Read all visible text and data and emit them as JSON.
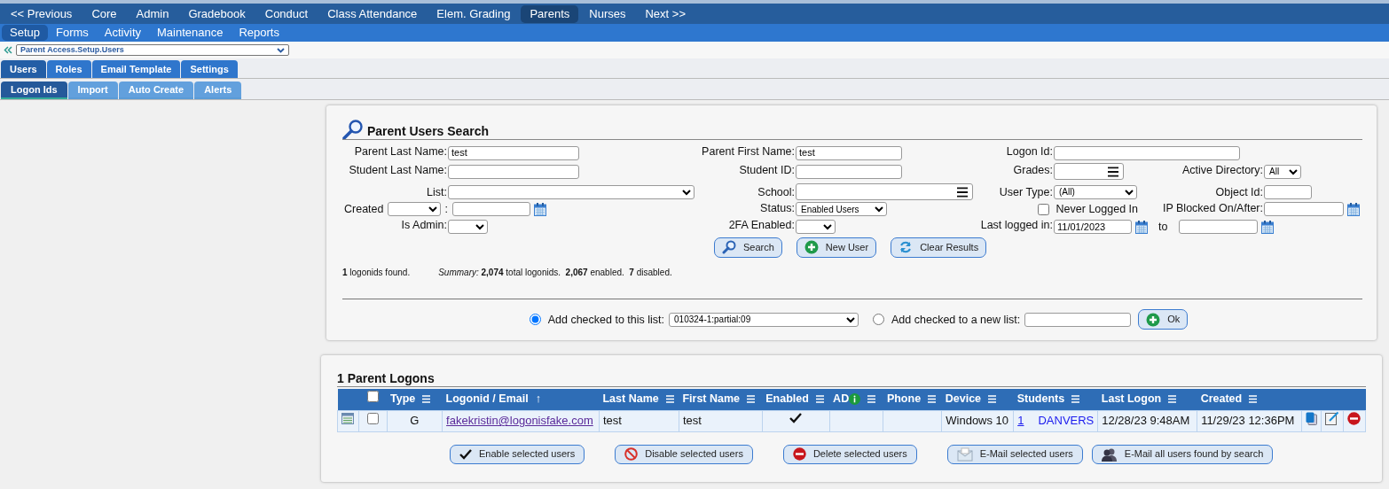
{
  "top_nav": [
    {
      "label": "<< Previous",
      "selected": false
    },
    {
      "label": "Core",
      "selected": false
    },
    {
      "label": "Admin",
      "selected": false
    },
    {
      "label": "Gradebook",
      "selected": false
    },
    {
      "label": "Conduct",
      "selected": false
    },
    {
      "label": "Class Attendance",
      "selected": false
    },
    {
      "label": "Elem. Grading",
      "selected": false
    },
    {
      "label": "Parents",
      "selected": true
    },
    {
      "label": "Nurses",
      "selected": false
    },
    {
      "label": "Next >>",
      "selected": false
    }
  ],
  "sub_nav": [
    {
      "label": "Setup",
      "selected": true
    },
    {
      "label": "Forms",
      "selected": false
    },
    {
      "label": "Activity",
      "selected": false
    },
    {
      "label": "Maintenance",
      "selected": false
    },
    {
      "label": "Reports",
      "selected": false
    }
  ],
  "breadcrumb": {
    "value": "Parent Access.Setup.Users"
  },
  "tabs": [
    {
      "label": "Users",
      "selected": true
    },
    {
      "label": "Roles",
      "selected": false
    },
    {
      "label": "Email Template",
      "selected": false
    },
    {
      "label": "Settings",
      "selected": false
    }
  ],
  "subtabs": [
    {
      "label": "Logon Ids",
      "selected": true
    },
    {
      "label": "Import",
      "selected": false
    },
    {
      "label": "Auto Create",
      "selected": false
    },
    {
      "label": "Alerts",
      "selected": false
    }
  ],
  "search": {
    "title": "Parent Users Search",
    "fields": [
      {
        "kind": "text",
        "label": "Parent Last Name:",
        "value": "test"
      },
      {
        "kind": "text",
        "label": "Parent First Name:",
        "value": "test"
      },
      {
        "kind": "text",
        "label": "Logon Id:"
      },
      {
        "kind": "text",
        "label": "Student Last Name:"
      },
      {
        "kind": "text",
        "label": "Student ID:"
      },
      {
        "kind": "lookup",
        "label": "Grades:"
      },
      {
        "kind": "select",
        "label": "Active Directory:",
        "value": "All"
      },
      {
        "kind": "select",
        "label": "List:"
      },
      {
        "kind": "lookup",
        "label": "School:"
      },
      {
        "kind": "select",
        "label": "User Type:",
        "value": "(All)"
      },
      {
        "kind": "text",
        "label": "Object Id:"
      },
      {
        "kind": "select_date",
        "label": "Created",
        "separator": ":"
      },
      {
        "kind": "select",
        "label": "Status:",
        "value": "Enabled Users"
      },
      {
        "kind": "checkbox",
        "label": "Never Logged In",
        "checked": false
      },
      {
        "kind": "date",
        "label": "IP Blocked On/After:"
      },
      {
        "kind": "select",
        "label": "Is Admin:"
      },
      {
        "kind": "select",
        "label": "2FA Enabled:"
      },
      {
        "kind": "date_range",
        "label": "Last logged in:",
        "value": "11/01/2023",
        "separator": "to"
      }
    ],
    "buttons": [
      {
        "label": "Search"
      },
      {
        "label": "New User"
      },
      {
        "label": "Clear Results"
      }
    ],
    "found": "**1** logonids found.",
    "summary": "*Summary:* **2,074** total logonids.  **2,067** enabled.  **7** disabled.",
    "list_options": [
      {
        "label": "Add checked to this list:",
        "selected": true,
        "kind": "select",
        "value": "010324-1:partial:09"
      },
      {
        "label": "Add checked to a new list:",
        "selected": false,
        "kind": "text"
      }
    ],
    "ok_button": "Ok"
  },
  "results": {
    "title": "1 Parent Logons",
    "select_all_checked": false,
    "columns": [
      {
        "label": "Type"
      },
      {
        "label": "Logonid / Email",
        "sort": "↑"
      },
      {
        "label": "Last Name"
      },
      {
        "label": "First Name"
      },
      {
        "label": "Enabled"
      },
      {
        "label": "AD",
        "info": true
      },
      {
        "label": "Phone"
      },
      {
        "label": "Device"
      },
      {
        "label": "Students"
      },
      {
        "label": "Last Logon"
      },
      {
        "label": "Created"
      }
    ],
    "rows": [
      {
        "checked": false,
        "type": "G",
        "logonid": "fakekristin@logonisfake.com",
        "last_name": "test",
        "first_name": "test",
        "enabled": true,
        "device": "Windows 10",
        "student_count": "1",
        "student_name": "DANVERS",
        "last_logon": "12/28/23 9:48AM",
        "created": "11/29/23 12:36PM"
      }
    ],
    "buttons": [
      {
        "label": "Enable selected users"
      },
      {
        "label": "Disable selected users"
      },
      {
        "label": "Delete selected users"
      },
      {
        "label": "E-Mail selected users"
      },
      {
        "label": "E-Mail all users found by search"
      }
    ]
  }
}
